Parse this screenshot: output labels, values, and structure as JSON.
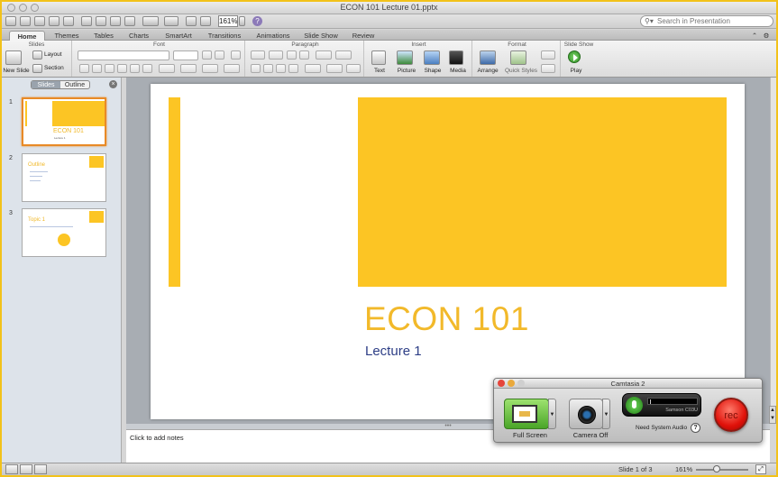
{
  "window": {
    "title": "ECON 101 Lecture 01.pptx"
  },
  "toolbar": {
    "zoom": "161%",
    "search_placeholder": "Search in Presentation"
  },
  "tabs": [
    {
      "label": "Home",
      "active": true
    },
    {
      "label": "Themes"
    },
    {
      "label": "Tables"
    },
    {
      "label": "Charts"
    },
    {
      "label": "SmartArt"
    },
    {
      "label": "Transitions"
    },
    {
      "label": "Animations"
    },
    {
      "label": "Slide Show"
    },
    {
      "label": "Review"
    }
  ],
  "ribbon": {
    "groups": {
      "slides": "Slides",
      "font": "Font",
      "paragraph": "Paragraph",
      "insert": "Insert",
      "format": "Format",
      "slideshow": "Slide Show"
    },
    "new_slide": "New Slide",
    "layout": "Layout",
    "section": "Section",
    "text": "Text",
    "picture": "Picture",
    "shape": "Shape",
    "media": "Media",
    "arrange": "Arrange",
    "quick_styles": "Quick Styles",
    "play": "Play"
  },
  "sidebar": {
    "tab_slides": "Slides",
    "tab_outline": "Outline",
    "thumbnails": [
      {
        "number": "1",
        "title": "ECON 101",
        "sub": "Lecture 1",
        "selected": true
      },
      {
        "number": "2",
        "title": "Outline"
      },
      {
        "number": "3",
        "title": "Topic 1"
      }
    ]
  },
  "slide": {
    "title": "ECON 101",
    "subtitle": "Lecture 1"
  },
  "notes": {
    "placeholder": "Click to add notes"
  },
  "status": {
    "slide_position": "Slide 1 of 3",
    "zoom": "161%"
  },
  "camtasia": {
    "title": "Camtasia 2",
    "full_screen": "Full Screen",
    "camera_off": "Camera Off",
    "audio_device": "Samson C03U",
    "system_audio": "Need System Audio",
    "rec": "rec"
  },
  "colors": {
    "accent_yellow": "#fcc524",
    "title_gold": "#f2b92a",
    "subtitle_navy": "#2d3e86",
    "frame_border": "#f2c21a",
    "rec_red": "#e0120a"
  }
}
